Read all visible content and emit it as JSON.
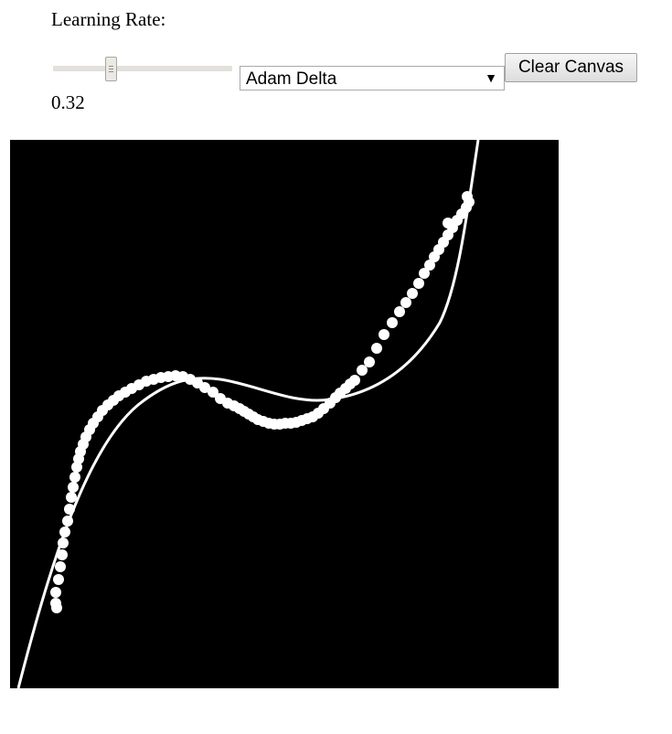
{
  "controls": {
    "learning_rate_label": "Learning Rate:",
    "learning_rate_value": "0.32",
    "learning_rate_fraction": 0.32,
    "optimizer": {
      "selected": "Adam Delta"
    },
    "clear_button": "Clear Canvas"
  },
  "canvas": {
    "background": "#000000",
    "foreground": "#ffffff"
  }
}
